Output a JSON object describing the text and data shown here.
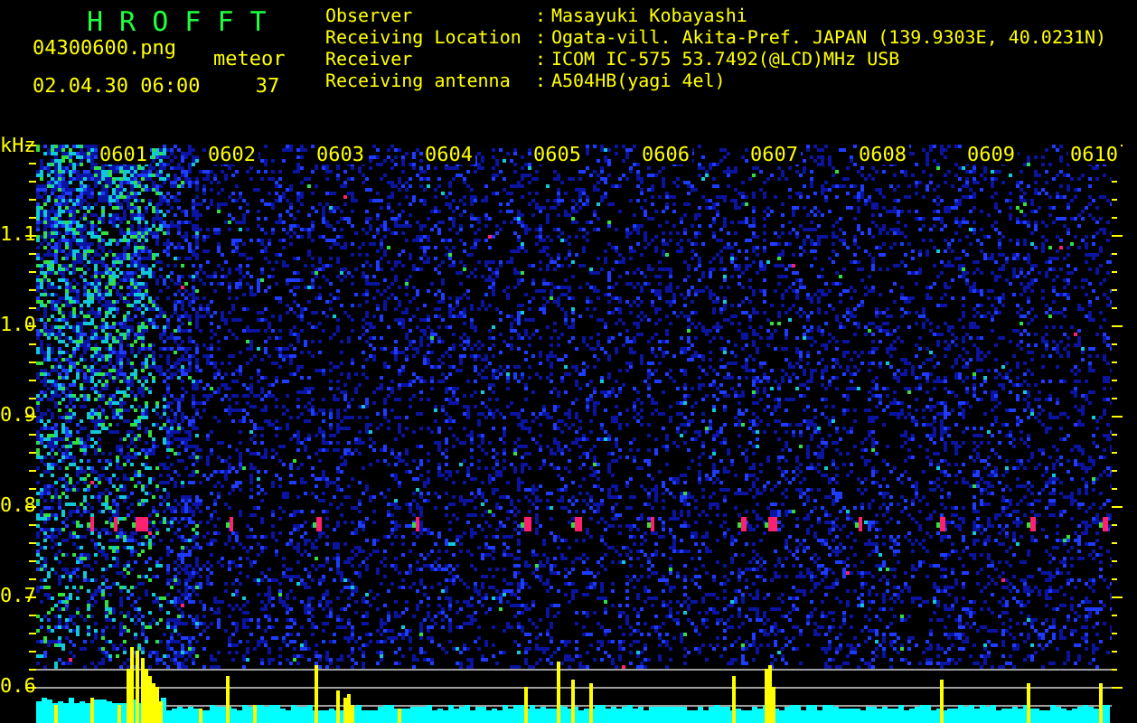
{
  "app_title": "H R O F F T",
  "file_name": "04300600.png",
  "timestamp": "02.04.30 06:00",
  "meteor": {
    "label": "meteor",
    "count": "37"
  },
  "info": [
    {
      "label": "Observer",
      "separator": ":",
      "value": "Masayuki Kobayashi"
    },
    {
      "label": "Receiving Location",
      "separator": ":",
      "value": "Ogata-vill. Akita-Pref. JAPAN (139.9303E, 40.0231N)"
    },
    {
      "label": "Receiver",
      "separator": ":",
      "value": "ICOM IC-575 53.7492(@LCD)MHz USB"
    },
    {
      "label": "Receiving antenna",
      "separator": ":",
      "value": "A504HB(yagi 4el)"
    }
  ],
  "y_axis": {
    "unit": "kHz",
    "ticks": [
      "1.1",
      "1.0",
      "0.9",
      "0.8",
      "0.7",
      "0.6"
    ]
  },
  "time_labels": [
    "0601",
    "0602",
    "0603",
    "0604",
    "0605",
    "0606",
    "0607",
    "0608",
    "0609",
    "0610"
  ]
}
